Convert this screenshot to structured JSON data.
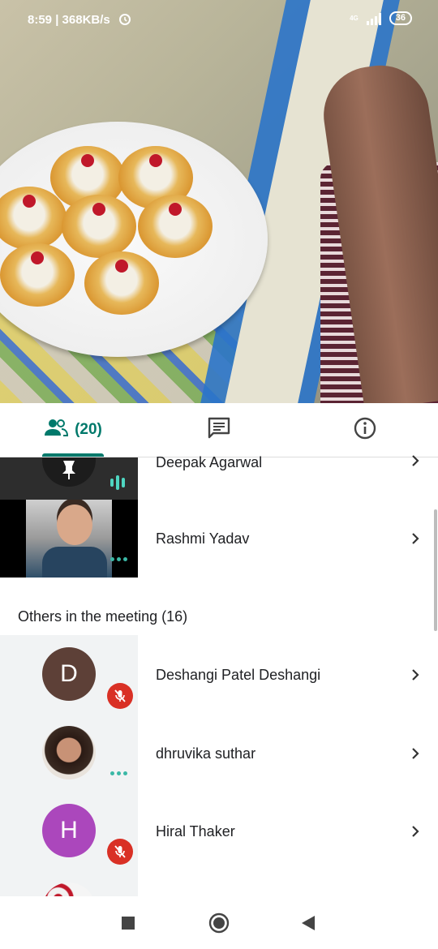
{
  "status_bar": {
    "time_speed": "8:59 | 368KB/s",
    "network": "4G",
    "battery": "36"
  },
  "tabs": [
    {
      "name": "people",
      "label": "(20)"
    },
    {
      "name": "chat",
      "label": ""
    },
    {
      "name": "info",
      "label": ""
    }
  ],
  "pinned_participants": [
    {
      "name": "Deepak Agarwal",
      "state": "speaking"
    },
    {
      "name": "Rashmi Yadav",
      "state": "more"
    }
  ],
  "others_section": {
    "title": "Others in the meeting (16)"
  },
  "others": [
    {
      "name": "Deshangi Patel Deshangi",
      "initial": "D",
      "avatar_color": "#5d4037",
      "muted": true
    },
    {
      "name": "dhruvika suthar",
      "initial": "",
      "avatar_color": "#6b4a3a",
      "muted": false
    },
    {
      "name": "Hiral Thaker",
      "initial": "H",
      "avatar_color": "#ab47bc",
      "muted": true
    }
  ],
  "colors": {
    "accent": "#00796b",
    "muted_badge": "#d93025"
  }
}
